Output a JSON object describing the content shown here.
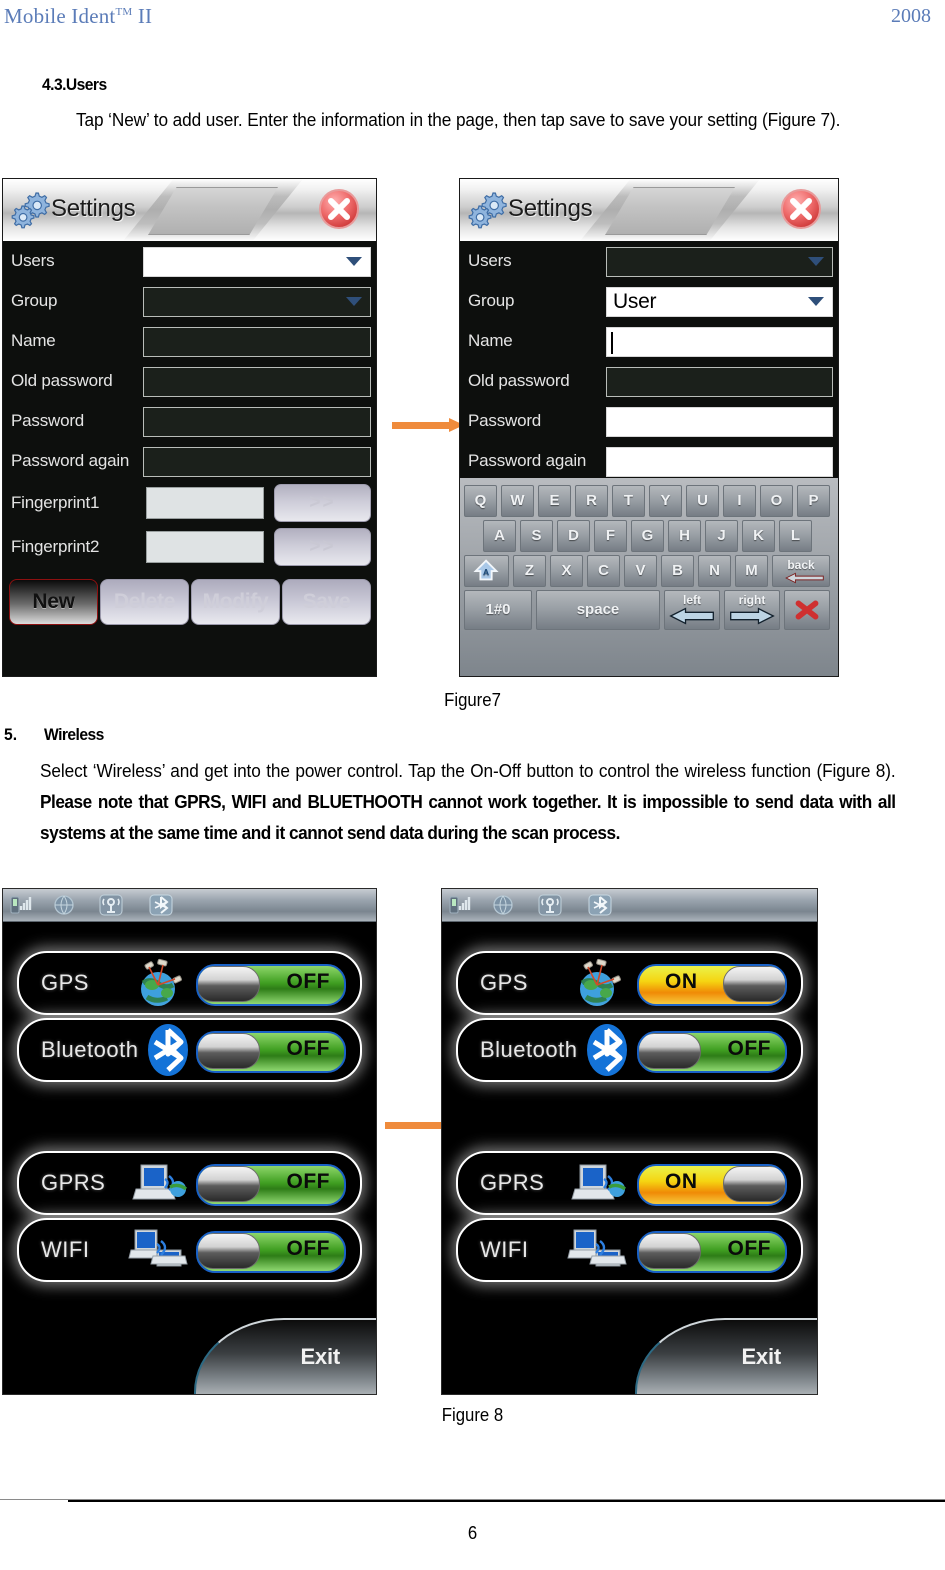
{
  "header": {
    "left_title": "Mobile Ident",
    "left_sup": "TM",
    "left_suffix": " II",
    "right_year": "2008"
  },
  "sections": {
    "users": {
      "number_title": "4.3.Users",
      "paragraph": "Tap ‘New’ to add user. Enter the information in the page, then tap save to save your setting (Figure 7).",
      "figure_caption": "Figure7"
    },
    "wireless": {
      "list_number": "5.",
      "title": "Wireless",
      "paragraph_normal_1": "Select ‘Wireless’ and get into the power control. Tap the On-Off button to control the wireless function (Figure 8). ",
      "paragraph_bold": "Please note that GPRS, WIFI and BLUETHOOTH cannot work together. It is impossible to send data with all systems at the same time and it cannot send data during the scan process.",
      "figure_caption": "Figure 8"
    }
  },
  "settings_dialog_left": {
    "title": "Settings",
    "gear_icon": "gears-icon",
    "close_icon": "close-icon",
    "fields": [
      {
        "label": "Users",
        "value": "",
        "type": "dropdown",
        "white": true
      },
      {
        "label": "Group",
        "value": "",
        "type": "dropdown",
        "white": false
      },
      {
        "label": "Name",
        "value": "",
        "type": "text",
        "white": false
      },
      {
        "label": "Old password",
        "value": "",
        "type": "text",
        "white": false
      },
      {
        "label": "Password",
        "value": "",
        "type": "text",
        "white": false
      },
      {
        "label": "Password again",
        "value": "",
        "type": "text",
        "white": false
      }
    ],
    "fingerprints": [
      {
        "label": "Fingerprint1",
        "value": "",
        "button": ">>"
      },
      {
        "label": "Fingerprint2",
        "value": "",
        "button": ">>"
      }
    ],
    "buttons": [
      {
        "label": "New",
        "state": "active"
      },
      {
        "label": "Delete",
        "state": "disabled"
      },
      {
        "label": "Modify",
        "state": "disabled"
      },
      {
        "label": "Save",
        "state": "disabled"
      }
    ]
  },
  "settings_dialog_right": {
    "title": "Settings",
    "gear_icon": "gears-icon",
    "close_icon": "close-icon",
    "fields": [
      {
        "label": "Users",
        "value": "",
        "type": "dropdown",
        "white": false
      },
      {
        "label": "Group",
        "value": "User",
        "type": "dropdown",
        "white": true
      },
      {
        "label": "Name",
        "value": "",
        "type": "text",
        "white": true,
        "caret": true
      },
      {
        "label": "Old password",
        "value": "",
        "type": "text",
        "white": false
      },
      {
        "label": "Password",
        "value": "",
        "type": "text",
        "white": true
      },
      {
        "label": "Password again",
        "value": "",
        "type": "text",
        "white": true
      }
    ],
    "keyboard": {
      "row1": [
        "Q",
        "W",
        "E",
        "R",
        "T",
        "Y",
        "U",
        "I",
        "O",
        "P"
      ],
      "row2": [
        "A",
        "S",
        "D",
        "F",
        "G",
        "H",
        "J",
        "K",
        "L"
      ],
      "row3_shift": "shift-icon",
      "row3": [
        "Z",
        "X",
        "C",
        "V",
        "B",
        "N",
        "M"
      ],
      "row3_back": "back",
      "row4_numeric": "1#0",
      "row4_space": "space",
      "row4_left": "left",
      "row4_right": "right",
      "row4_close": "close-icon"
    }
  },
  "wireless_screen_left": {
    "status_icons": [
      "signal-icon",
      "globe-icon",
      "radio-tower-icon",
      "bluetooth-icon"
    ],
    "rows": [
      {
        "label": "GPS",
        "icon": "gps-globe-icon",
        "state": "OFF"
      },
      {
        "label": "Bluetooth",
        "icon": "bluetooth-icon",
        "state": "OFF"
      },
      {
        "label": "GPRS",
        "icon": "gprs-laptop-icon",
        "state": "OFF"
      },
      {
        "label": "WIFI",
        "icon": "wifi-laptops-icon",
        "state": "OFF"
      }
    ],
    "exit_label": "Exit"
  },
  "wireless_screen_right": {
    "status_icons": [
      "signal-icon",
      "globe-icon",
      "radio-tower-icon",
      "bluetooth-icon"
    ],
    "rows": [
      {
        "label": "GPS",
        "icon": "gps-globe-icon",
        "state": "ON"
      },
      {
        "label": "Bluetooth",
        "icon": "bluetooth-icon",
        "state": "OFF"
      },
      {
        "label": "GPRS",
        "icon": "gprs-laptop-icon",
        "state": "ON"
      },
      {
        "label": "WIFI",
        "icon": "wifi-laptops-icon",
        "state": "OFF"
      }
    ],
    "exit_label": "Exit"
  },
  "footer": {
    "page_number": "6"
  },
  "colors": {
    "header_blue": "#5b7cb8",
    "arrow_orange": "#ef8b3c",
    "toggle_off_green": "#3f9e21",
    "toggle_on_yellow": "#f5d512",
    "toggle_border_blue": "#1961c6"
  }
}
